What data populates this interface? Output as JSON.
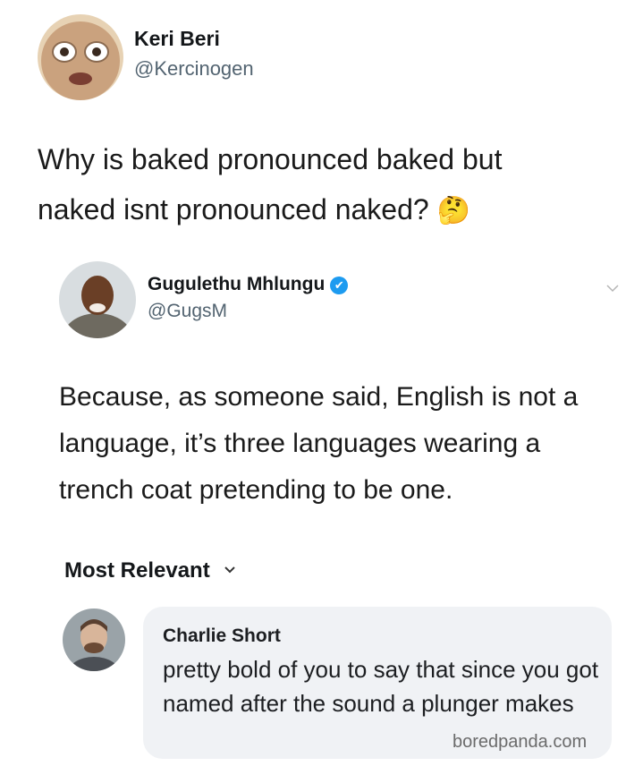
{
  "tweet1": {
    "name": "Keri Beri",
    "handle": "@Kercinogen",
    "text": "Why is baked pronounced baked but naked isnt pronounced naked?",
    "emoji": "🤔"
  },
  "tweet2": {
    "name": "Gugulethu Mhlungu",
    "handle": "@GugsM",
    "verified_icon": "✔",
    "text": "Because, as someone said, English is not a language, it’s three languages wearing a trench coat pretending to be one."
  },
  "comments": {
    "sort_label": "Most Relevant",
    "sort_chevron": "⌄",
    "items": [
      {
        "name": "Charlie Short",
        "text": "pretty bold of you to say that since you got named after the sound a plunger makes"
      }
    ]
  },
  "watermark": "boredpanda.com",
  "colors": {
    "verified": "#1d9bf0",
    "bubble": "#f0f2f5"
  }
}
